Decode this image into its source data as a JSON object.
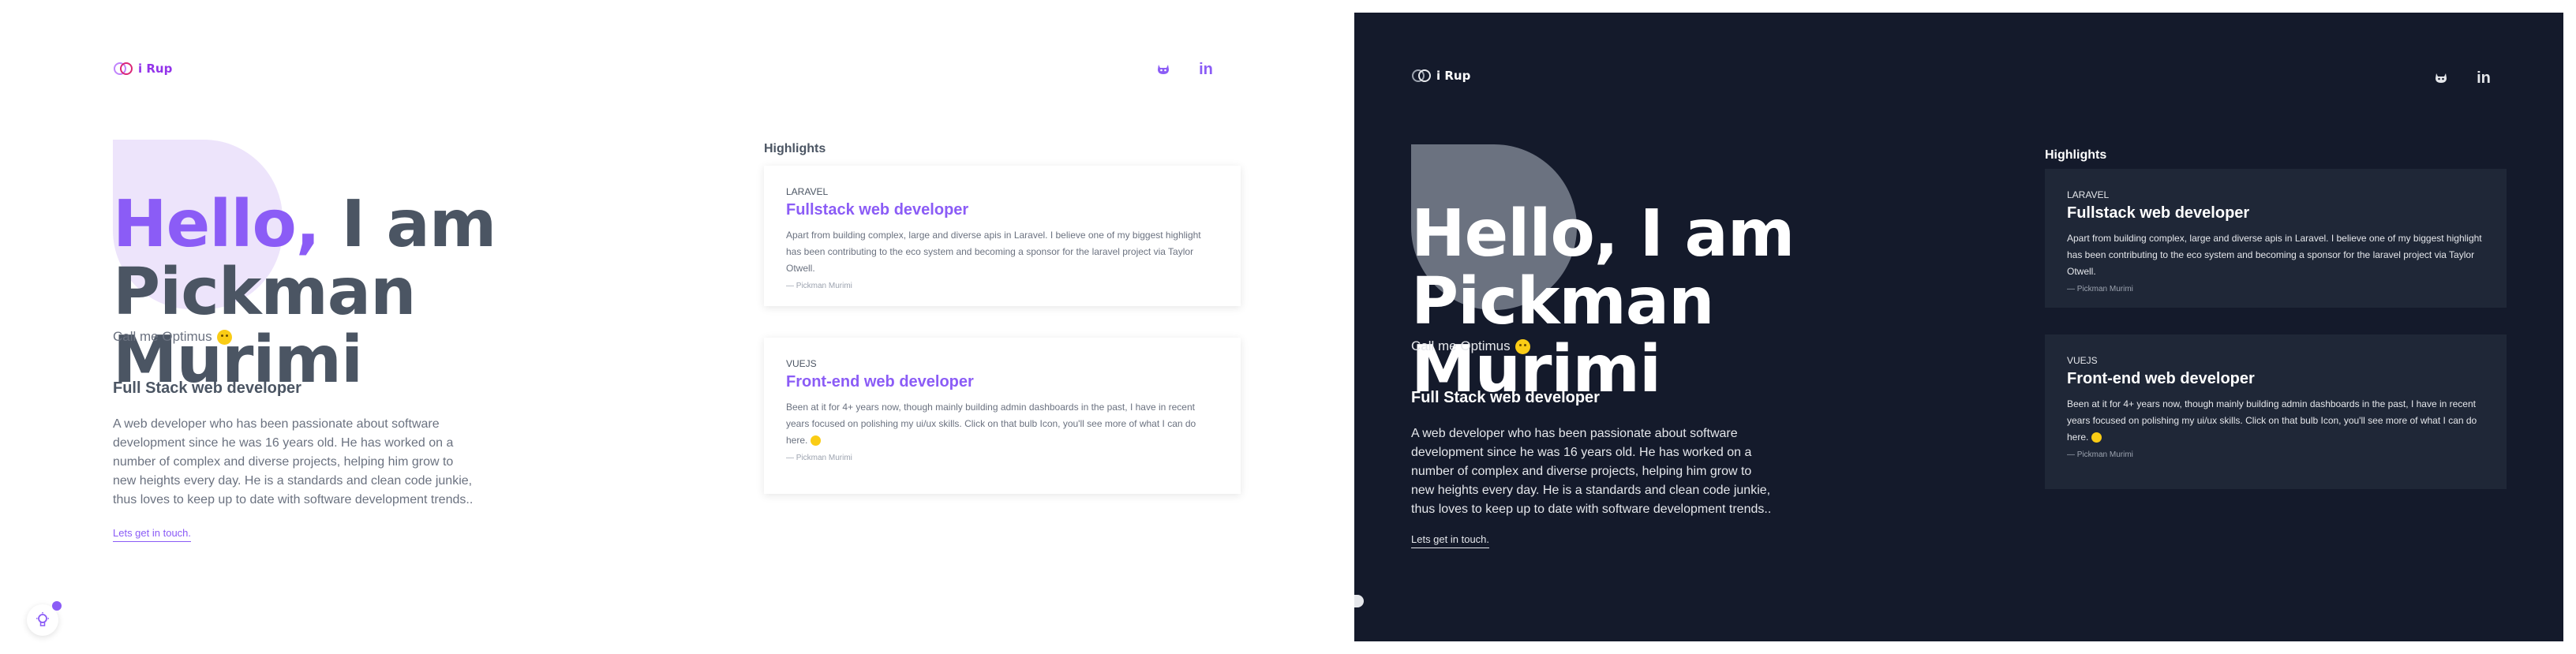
{
  "brand": {
    "name": "i Rup",
    "accent": "#8b5cf6",
    "dark_bg": "#141a2b"
  },
  "social": [
    {
      "icon": "github-icon"
    },
    {
      "icon": "linkedin-icon",
      "text": "in"
    }
  ],
  "hero": {
    "hello": "Hello,",
    "rest_line1": " I am Pickman",
    "rest_line2": "Murimi",
    "nickname": "Call me Optimus"
  },
  "about": {
    "role": "Full Stack web developer",
    "bio": "A web developer who has been passionate about software development since he was 16 years old. He has worked on a number of complex and diverse projects, helping him grow to new heights every day. He is a standards and clean code junkie, thus loves to keep up to date with software development trends..",
    "cta": "Lets get in touch."
  },
  "highlights": {
    "title": "Highlights",
    "items": [
      {
        "tag": "LARAVEL",
        "title": "Fullstack web developer",
        "body": "Apart from building complex, large and diverse apis in Laravel. I believe one of my biggest highlight has been contributing to the eco system and becoming a sponsor for the laravel project via Taylor Otwell.",
        "author": "— Pickman Murimi"
      },
      {
        "tag": "VUEJS",
        "title": "Front-end web developer",
        "body": "Been at it for 4+ years now, though mainly building admin dashboards in the past, I have in recent years focused on polishing my ui/ux skills. Click on that bulb Icon, you'll see more of what I can do here.",
        "author": "— Pickman Murimi"
      }
    ]
  },
  "dark": {
    "bio": "A web developer who has been passionate about software development since he was 16 years old. He has worked on a number of complex and diverse projects, helping him grow to new heights every day. He is a standards and clean code junkie, thus loves to keep up to date with software development trends..",
    "item1_body": "Apart from building complex, large and diverse apis in Laravel. I believe one of my biggest highlight has been contributing to the eco system and becoming a sponsor for the laravel project via Taylor Otwell.",
    "item2_body": "Been at it for 4+ years now, though mainly building admin dashboards in the past, I have in recent years focused on polishing my ui/ux skills. Click on that bulb Icon, you'll see more of what I can do here."
  }
}
